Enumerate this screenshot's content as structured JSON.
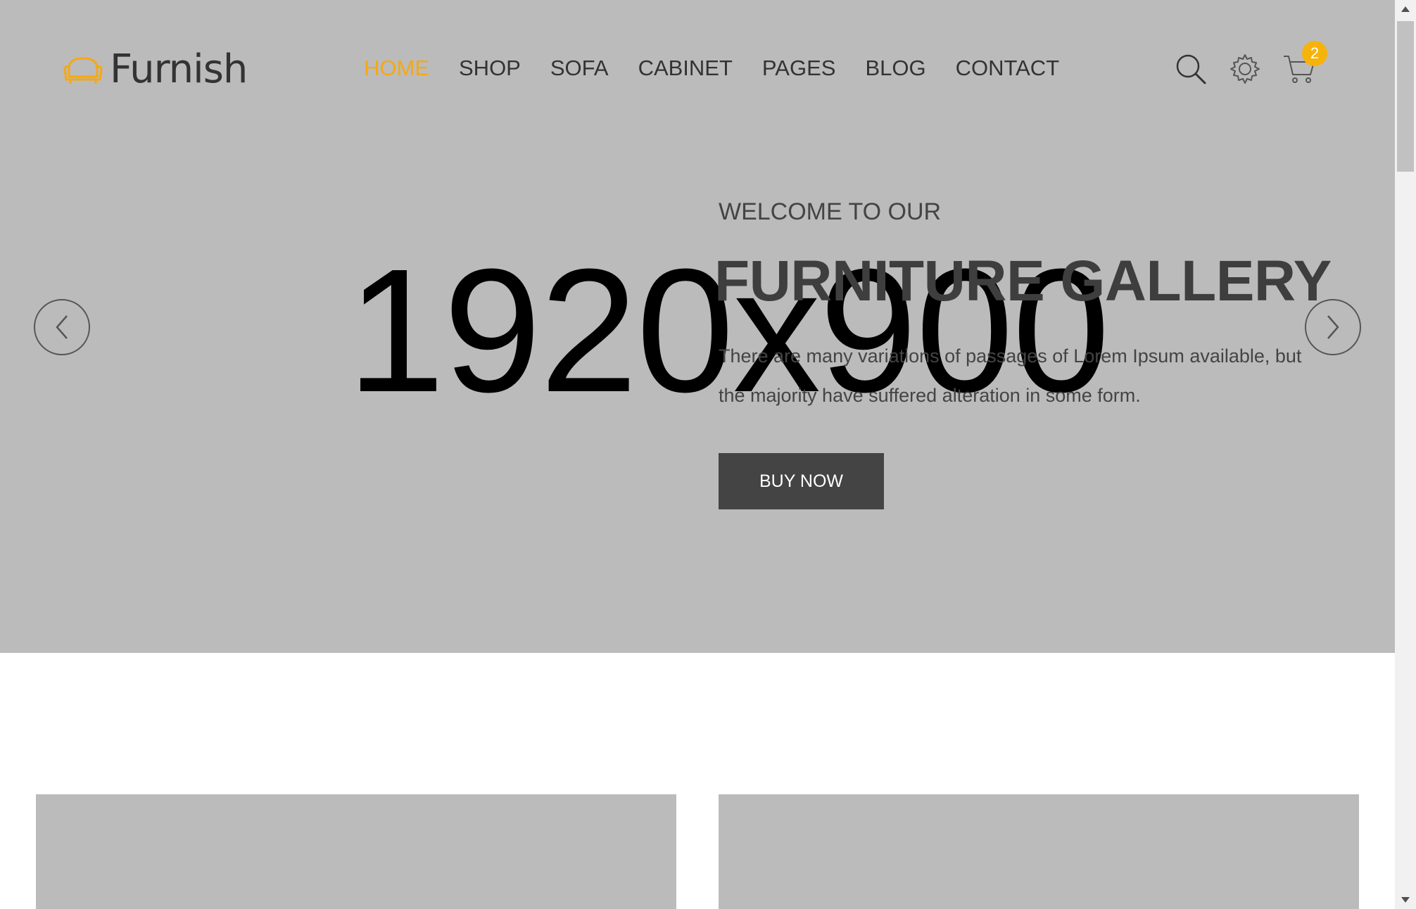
{
  "brand": {
    "name": "Furnish",
    "accent_color": "#f5a814"
  },
  "nav": {
    "items": [
      {
        "label": "HOME",
        "active": true
      },
      {
        "label": "SHOP",
        "active": false
      },
      {
        "label": "SOFA",
        "active": false
      },
      {
        "label": "CABINET",
        "active": false
      },
      {
        "label": "PAGES",
        "active": false
      },
      {
        "label": "BLOG",
        "active": false
      },
      {
        "label": "CONTACT",
        "active": false
      }
    ]
  },
  "header_icons": {
    "search": "search-icon",
    "settings": "gear-icon",
    "cart": "cart-icon",
    "cart_count": "2"
  },
  "hero": {
    "placeholder_size": "1920x900",
    "subtitle": "WELCOME TO OUR",
    "title": "FURNITURE GALLERY",
    "description": "There are many variations of passages of Lorem Ipsum available, but the majority have suffered alteration in some form.",
    "button_label": "BUY NOW",
    "prev_icon": "chevron-left-icon",
    "next_icon": "chevron-right-icon"
  }
}
